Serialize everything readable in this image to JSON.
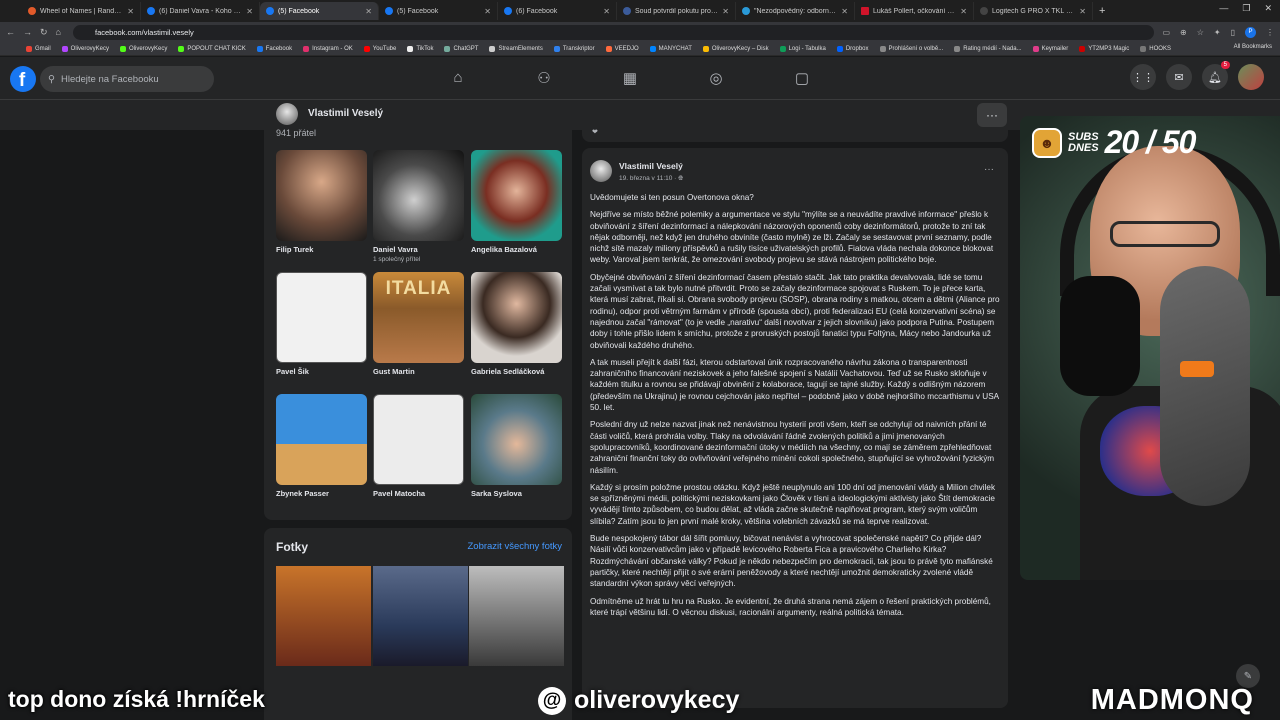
{
  "browser": {
    "tabs": [
      {
        "title": "Wheel of Names | Random nam",
        "active": false
      },
      {
        "title": "(6) Daniel Vavra - Koho čist a s",
        "active": false
      },
      {
        "title": "(5) Facebook",
        "active": true
      },
      {
        "title": "(5) Facebook",
        "active": false
      },
      {
        "title": "(6) Facebook",
        "active": false
      },
      {
        "title": "Soud potvrdil pokutu pro advo",
        "active": false
      },
      {
        "title": "\"Nezodpovědný: odborně neo",
        "active": false
      },
      {
        "title": "Lukáš Pollert, očkování a mutac",
        "active": false
      },
      {
        "title": "Logitech G PRO X TKL LIGHTSP",
        "active": false
      }
    ],
    "url": "facebook.com/vlastimil.vesely",
    "profile_initial": "P",
    "bookmarks": [
      "Gmail",
      "OliverovyKecy",
      "OliverovyKecy",
      "POPOUT CHAT KICK",
      "Facebook",
      "Instagram - OK",
      "YouTube",
      "TikTok",
      "ChatGPT",
      "StreamElements",
      "Transkriptor",
      "VEEDJO",
      "MANYCHAT",
      "OliverovyKecy – Disk",
      "Logi - Tabulka",
      "Dropbox",
      "Prohlášení o volbě...",
      "Rating médií - Nada...",
      "Keymailer",
      "YT2MP3 Magic",
      "HOOKS"
    ],
    "all_bookmarks": "All Bookmarks"
  },
  "facebook": {
    "search_placeholder": "Hledejte na Facebooku",
    "notification_count": "5",
    "profile_name": "Vlastimil Veselý",
    "friends_count_text": "941 přátel",
    "friends": [
      {
        "name": "Filip Turek",
        "meta": ""
      },
      {
        "name": "Daniel Vavra",
        "meta": "1 společný přítel"
      },
      {
        "name": "Angelika Bazalová",
        "meta": ""
      },
      {
        "name": "Pavel Šik",
        "meta": ""
      },
      {
        "name": "Gust Martin",
        "meta": ""
      },
      {
        "name": "Gabriela Sedláčková",
        "meta": ""
      },
      {
        "name": "Zbynek Passer",
        "meta": ""
      },
      {
        "name": "Pavel Matocha",
        "meta": ""
      },
      {
        "name": "Sarka Syslova",
        "meta": ""
      }
    ],
    "italia_text": "ITALIA",
    "photos_title": "Fotky",
    "photos_link": "Zobrazit všechny fotky",
    "post": {
      "author": "Vlastimil Veselý",
      "date": "19. března v 11:10 · ",
      "paragraphs": [
        "Uvědomujete si ten posun Overtonova okna?",
        "Nejdříve se místo běžné polemiky a argumentace ve stylu \"mýlíte se a neuvádíte pravdivé informace\" přešlo k obviňování z šíření dezinformací a nálepkování názorových oponentů coby dezinformátorů, protože to zní tak nějak odborněji, než když jen druhého obviníte (často mylně) ze lži. Začaly se sestavovat první seznamy, podle nichž sítě mazaly miliony příspěvků a rušily tisíce uživatelských profilů. Fialova vláda nechala dokonce blokovat weby. Varoval jsem tenkrát, že omezování svobody projevu se stává nástrojem politického boje.",
        "Obyčejné obviňování z šíření dezinformací časem přestalo stačit. Jak tato praktika devalvovala, lidé se tomu začali vysmívat a tak bylo nutné přitvrdit. Proto se začaly dezinformace spojovat s Ruskem. To je přece karta, která musí zabrat, říkali si. Obrana svobody projevu (SOSP), obrana rodiny s matkou, otcem a dětmi (Aliance pro rodinu), odpor proti větrným farmám v přírodě (spousta obcí), proti federalizaci EU (celá konzervativní scéna) se najednou začal \"rámovat\" (to je vedle „narativu“ další novotvar z jejich slovníku) jako podpora Putina. Postupem doby i tohle přišlo lidem k smíchu, protože z proruských postojů fanatici typu Foltýna, Mácy nebo Jandourka už obviňovali každého druhého.",
        "A tak museli přejít k další fázi, kterou odstartoval únik rozpracovaného návrhu zákona o transparentnosti zahraničního financování neziskovek a jeho falešné spojení s Natálií Vachatovou. Teď už se Rusko skloňuje v každém titulku a rovnou se přidávají obvinění z kolaborace, tagují se tajné služby. Každý s odlišným názorem (především na Ukrajinu) je rovnou cejchován jako nepřítel – podobně jako v době nejhoršího mccarthismu v USA 50. let.",
        "Poslední dny už nelze nazvat jinak než nenávistnou hysterií proti všem, kteří se odchylují od naivních přání té části voličů, která prohrála volby. Tlaky na odvolávání řádně zvolených politiků a jimi jmenovaných spolupracovníků, koordinované dezinformační útoky v médiích na všechny, co mají se záměrem zpřehledňovat zahraniční finanční toky do ovlivňování veřejného mínění cokoli společného, stupňující se vyhrožování fyzickým násilím.",
        "Každý si prosím položme prostou otázku. Když ještě neuplynulo ani 100 dní od jmenování vlády a Milion chvilek se spřízněnými médii, politickými neziskovkami jako Člověk v tísni a ideologickými aktivisty jako Štít demokracie vyvádějí tímto způsobem, co budou dělat, až vláda začne skutečně naplňovat program, který svým voličům slíbila? Zatím jsou to jen první malé kroky, většina volebních závazků se má teprve realizovat.",
        "Bude nespokojený tábor dál šířit pomluvy, bičovat nenávist a vyhrocovat společenské napětí? Co přijde dál? Násilí vůči konzervativcům jako v případě levicového Roberta Fica a pravicového Charlieho Kirka? Rozdmýchávání občanské války? Pokud je někdo nebezpečím pro demokracii, tak jsou to právě tyto mafiánské partičky, které nechtějí přijít o své erární peněžovody a které nechtějí umožnit demokraticky zvolené vládě standardní výkon správy věcí veřejných.",
        "Odmítněme už hrát tu hru na Rusko. Je evidentní, že druhá strana nemá zájem o řešení praktických problémů, které trápí většinu lidí. O věcnou diskusi, racionální argumenty, reálná politická témata."
      ]
    }
  },
  "stream": {
    "subs_label_1": "SUBS",
    "subs_label_2": "DNES",
    "subs_value": "20 / 50",
    "overlay_left": "top dono získá !hrníček",
    "overlay_handle": "oliverovykecy",
    "overlay_right": "MADMONQ"
  }
}
